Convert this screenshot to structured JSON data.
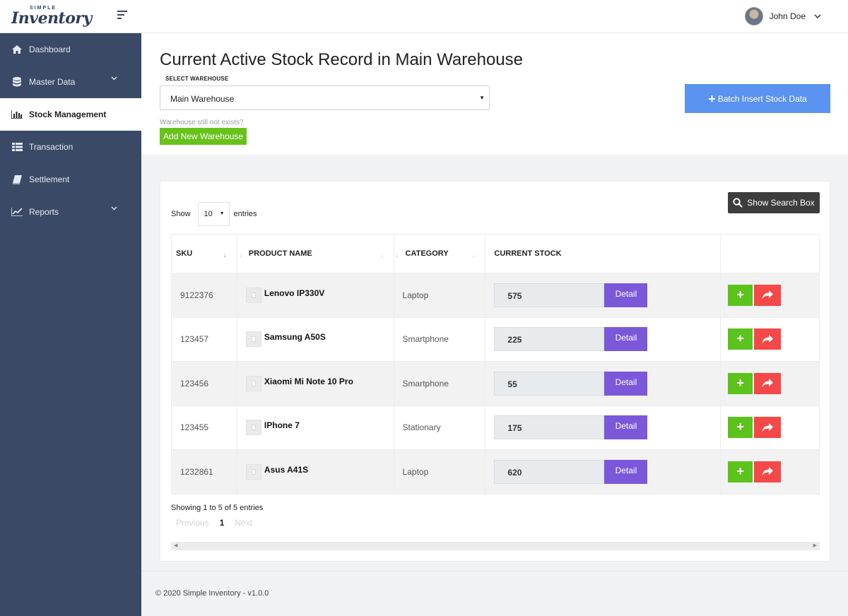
{
  "brand": {
    "small": "SIMPLE",
    "big": "Inventory"
  },
  "user": {
    "name": "John Doe"
  },
  "sidebar": {
    "items": [
      {
        "label": "Dashboard",
        "icon": "home-icon"
      },
      {
        "label": "Master Data",
        "icon": "database-icon",
        "has_submenu": true
      },
      {
        "label": "Stock Management",
        "icon": "bar-chart-icon",
        "active": true
      },
      {
        "label": "Transaction",
        "icon": "list-icon"
      },
      {
        "label": "Settlement",
        "icon": "book-icon"
      },
      {
        "label": "Reports",
        "icon": "line-chart-icon",
        "has_submenu": true
      }
    ]
  },
  "header": {
    "title": "Current Active Stock Record in Main Warehouse",
    "select_label": "SELECT WAREHOUSE",
    "selected_warehouse": "Main Warehouse",
    "hint": "Warehouse still not exists?",
    "add_warehouse_label": "Add New Warehouse",
    "batch_insert_label": "Batch Insert Stock Data"
  },
  "table_controls": {
    "show_label": "Show",
    "entries_value": "10",
    "entries_label": "entries",
    "search_button": "Show Search Box"
  },
  "table": {
    "columns": [
      "SKU",
      "PRODUCT NAME",
      "CATEGORY",
      "CURRENT STOCK"
    ],
    "detail_label": "Detail",
    "rows": [
      {
        "sku": "9122376",
        "name": "Lenovo IP330V",
        "category": "Laptop",
        "stock": "575"
      },
      {
        "sku": "123457",
        "name": "Samsung A50S",
        "category": "Smartphone",
        "stock": "225"
      },
      {
        "sku": "123456",
        "name": "Xiaomi Mi Note 10 Pro",
        "category": "Smartphone",
        "stock": "55"
      },
      {
        "sku": "123455",
        "name": "IPhone 7",
        "category": "Stationary",
        "stock": "175"
      },
      {
        "sku": "1232861",
        "name": "Asus A41S",
        "category": "Laptop",
        "stock": "620"
      }
    ]
  },
  "pagination": {
    "info": "Showing 1 to 5 of 5 entries",
    "previous": "Previous",
    "current": "1",
    "next": "Next"
  },
  "footer": {
    "text": "© 2020 Simple Inventory - v1.0.0"
  },
  "colors": {
    "sidebar": "#3a4a66",
    "green": "#67c21a",
    "blue": "#5a93f0",
    "purple": "#7b58da",
    "red": "#f54848",
    "dark": "#3d3d3d"
  }
}
